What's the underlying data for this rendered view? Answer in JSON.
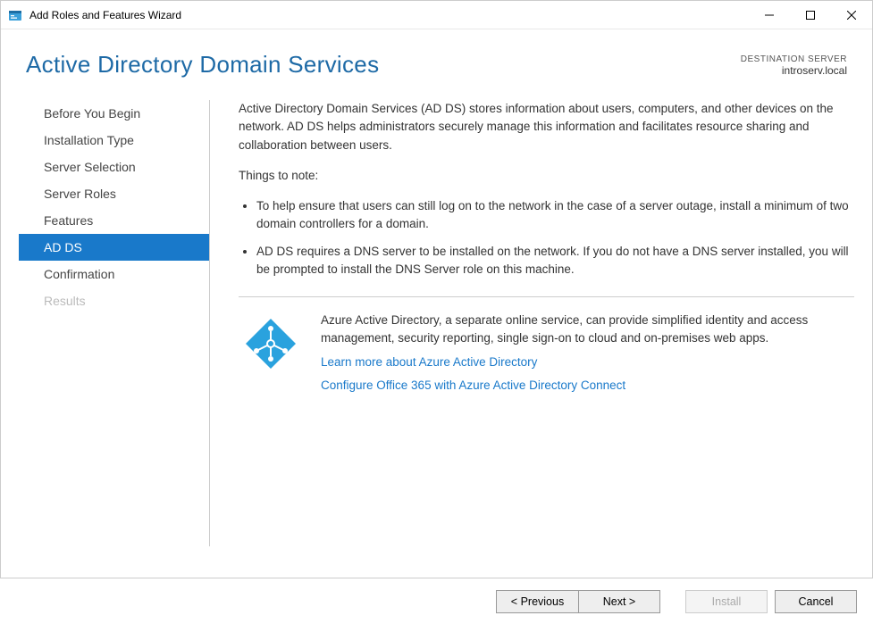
{
  "window": {
    "title": "Add Roles and Features Wizard"
  },
  "header": {
    "heading": "Active Directory Domain Services",
    "destination_label": "DESTINATION SERVER",
    "destination_name": "introserv.local"
  },
  "sidebar": {
    "items": [
      {
        "label": "Before You Begin",
        "state": "normal"
      },
      {
        "label": "Installation Type",
        "state": "normal"
      },
      {
        "label": "Server Selection",
        "state": "normal"
      },
      {
        "label": "Server Roles",
        "state": "normal"
      },
      {
        "label": "Features",
        "state": "normal"
      },
      {
        "label": "AD DS",
        "state": "selected"
      },
      {
        "label": "Confirmation",
        "state": "normal"
      },
      {
        "label": "Results",
        "state": "disabled"
      }
    ]
  },
  "content": {
    "intro": "Active Directory Domain Services (AD DS) stores information about users, computers, and other devices on the network.  AD DS helps administrators securely manage this information and facilitates resource sharing and collaboration between users.",
    "things_label": "Things to note:",
    "bullets": [
      "To help ensure that users can still log on to the network in the case of a server outage, install a minimum of two domain controllers for a domain.",
      "AD DS requires a DNS server to be installed on the network.  If you do not have a DNS server installed, you will be prompted to install the DNS Server role on this machine."
    ],
    "azure": {
      "desc": "Azure Active Directory, a separate online service, can provide simplified identity and access management, security reporting, single sign-on to cloud and on-premises web apps.",
      "link1": "Learn more about Azure Active Directory",
      "link2": "Configure Office 365 with Azure Active Directory Connect"
    }
  },
  "footer": {
    "previous": "< Previous",
    "next": "Next >",
    "install": "Install",
    "cancel": "Cancel"
  }
}
